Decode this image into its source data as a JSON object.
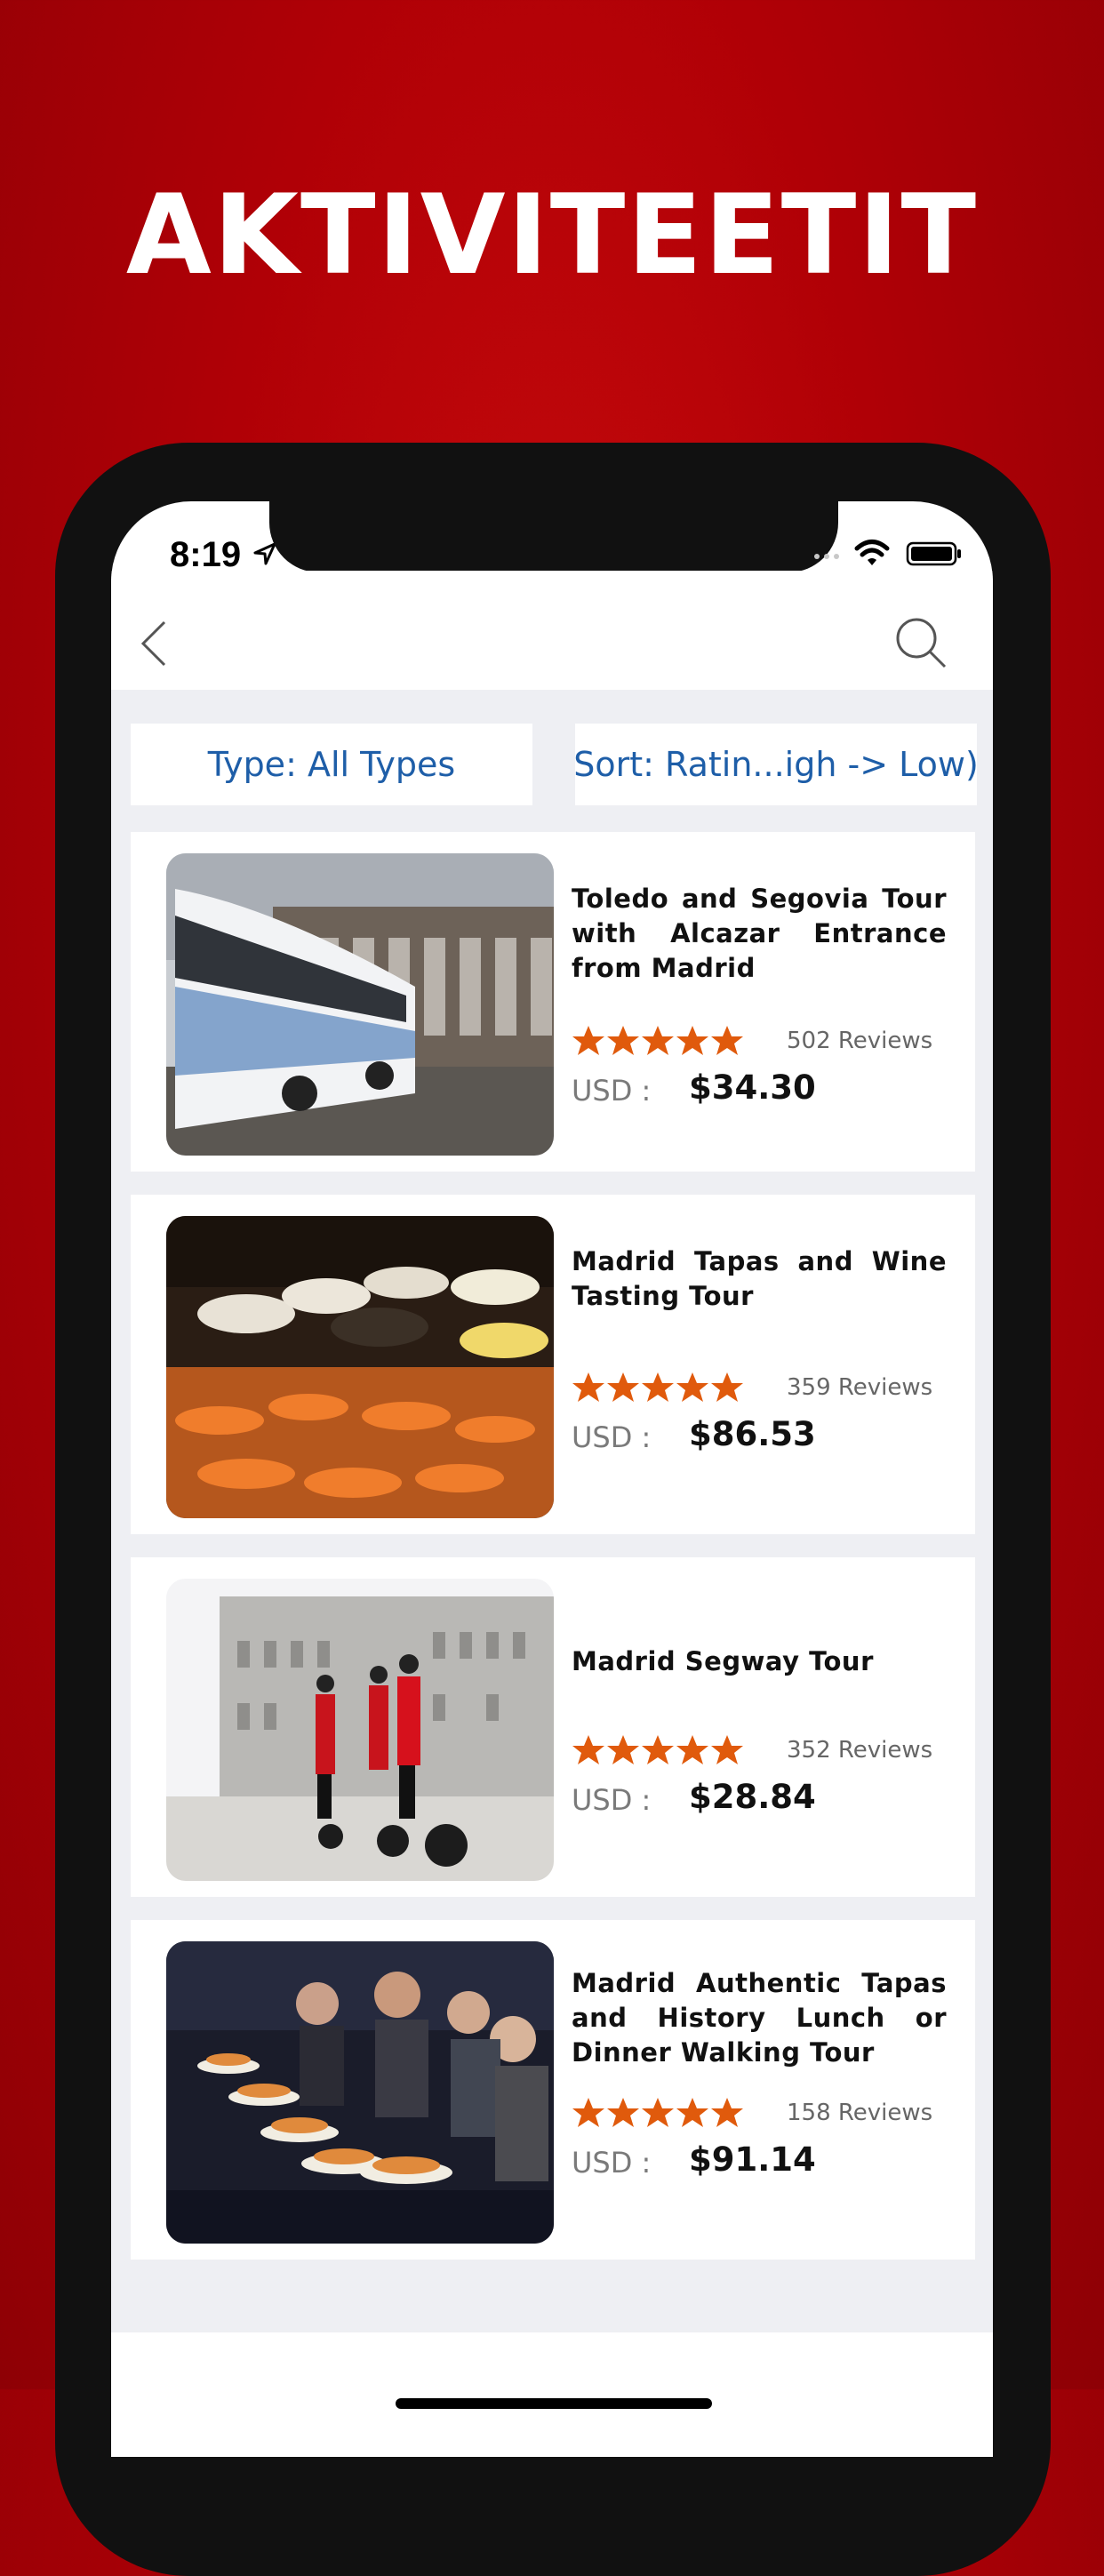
{
  "headline": "AKTIVITEETIT",
  "status_bar": {
    "time": "8:19"
  },
  "navbar": {
    "back": "back-icon",
    "search": "search-icon"
  },
  "filters": {
    "type_label": "Type: All Types",
    "sort_label": "Sort: Ratin...igh -> Low)"
  },
  "colors": {
    "accent": "#1e5ea8",
    "star": "#e05a0c",
    "brand_red": "#b00006"
  },
  "tours": [
    {
      "title": "Toledo and Segovia Tour with Alcazar Entrance from Madrid",
      "rating": 5,
      "reviews": "502 Reviews",
      "currency": "USD :",
      "price": "$34.30"
    },
    {
      "title": "Madrid Tapas and Wine Tasting Tour",
      "rating": 5,
      "reviews": "359 Reviews",
      "currency": "USD :",
      "price": "$86.53"
    },
    {
      "title": "Madrid Segway Tour",
      "rating": 5,
      "reviews": "352 Reviews",
      "currency": "USD :",
      "price": "$28.84"
    },
    {
      "title": "Madrid Authentic Tapas and History Lunch or Dinner Walking Tour",
      "rating": 5,
      "reviews": "158 Reviews",
      "currency": "USD :",
      "price": "$91.14"
    }
  ]
}
